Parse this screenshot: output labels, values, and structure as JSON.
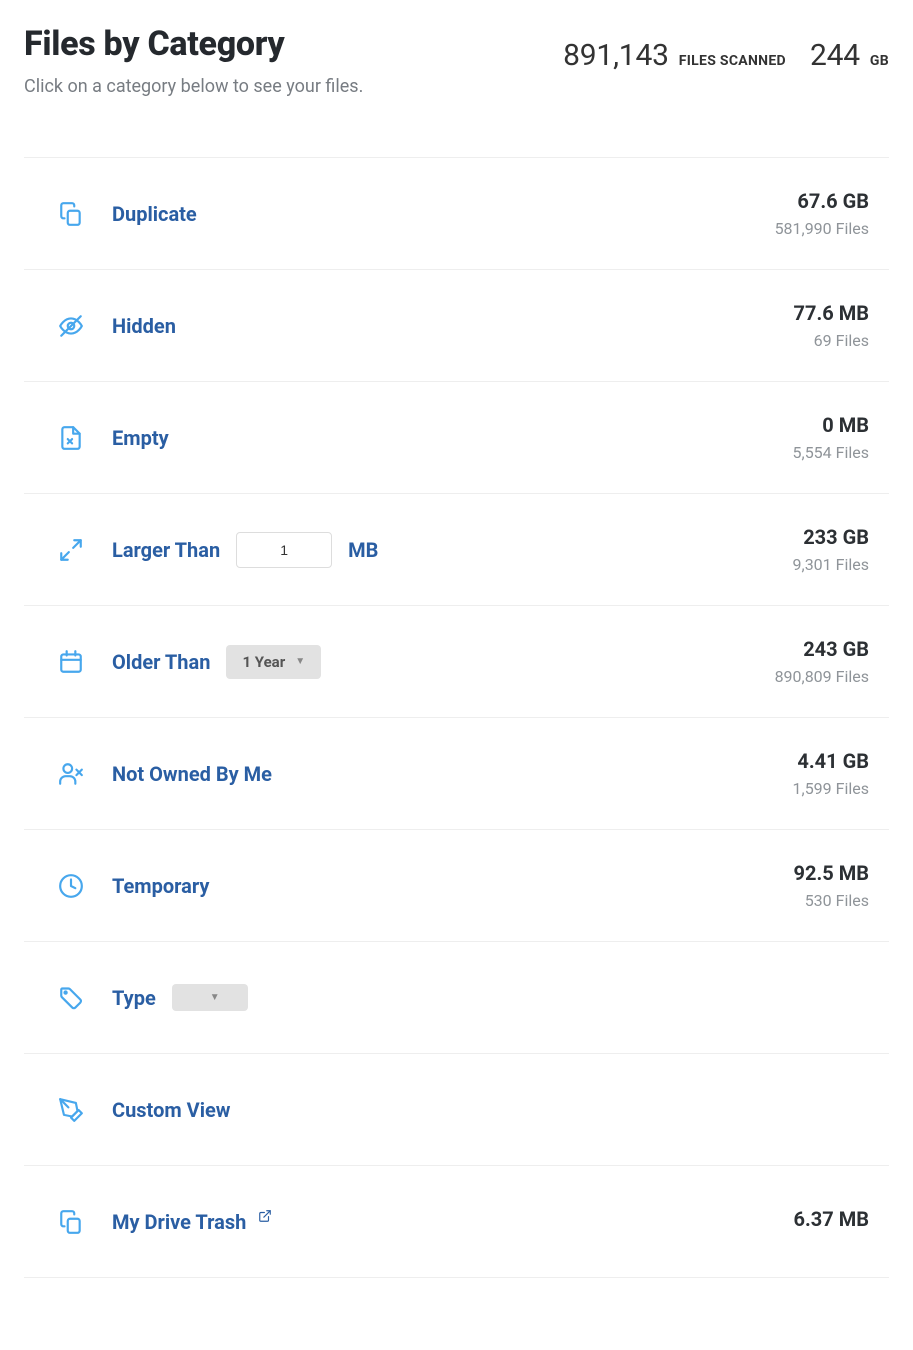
{
  "header": {
    "title": "Files by Category",
    "subtitle": "Click on a category below to see your files.",
    "files_scanned_value": "891,143",
    "files_scanned_label": "FILES SCANNED",
    "size_value": "244",
    "size_unit": "GB"
  },
  "categories": {
    "duplicate": {
      "label": "Duplicate",
      "size": "67.6 GB",
      "files": "581,990 Files"
    },
    "hidden": {
      "label": "Hidden",
      "size": "77.6 MB",
      "files": "69 Files"
    },
    "empty": {
      "label": "Empty",
      "size": "0 MB",
      "files": "5,554 Files"
    },
    "larger_than": {
      "label": "Larger Than",
      "input_value": "1",
      "unit": "MB",
      "size": "233 GB",
      "files": "9,301 Files"
    },
    "older_than": {
      "label": "Older Than",
      "selected": "1 Year",
      "size": "243 GB",
      "files": "890,809 Files"
    },
    "not_owned": {
      "label": "Not Owned By Me",
      "size": "4.41 GB",
      "files": "1,599 Files"
    },
    "temporary": {
      "label": "Temporary",
      "size": "92.5 MB",
      "files": "530 Files"
    },
    "type": {
      "label": "Type",
      "selected": ""
    },
    "custom_view": {
      "label": "Custom View"
    },
    "my_drive_trash": {
      "label": "My Drive Trash",
      "size": "6.37 MB"
    }
  }
}
